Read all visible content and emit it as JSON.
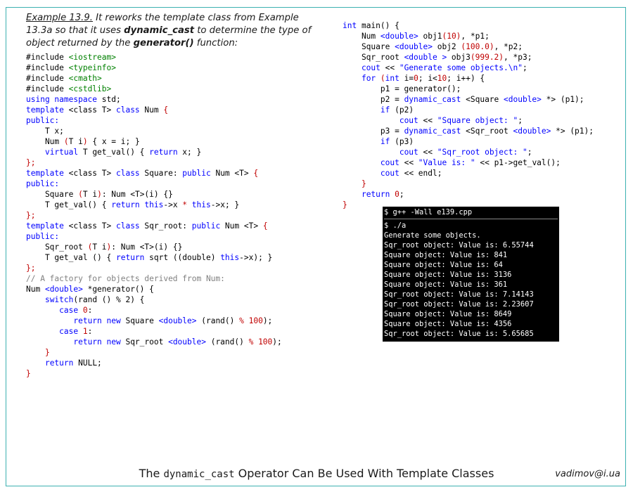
{
  "intro": {
    "example_label": "Example 13.9.",
    "text_1": " It reworks the template class from Example 13.3a so that it uses ",
    "kw_1": "dynamic_cast",
    "text_2": " to determine the type of object returned by the ",
    "kw_2": "generator()",
    "text_3": " function:"
  },
  "code_left": [
    [
      [
        "#include ",
        ""
      ],
      [
        "<iostream>",
        "inc"
      ]
    ],
    [
      [
        "#include ",
        ""
      ],
      [
        "<typeinfo>",
        "inc"
      ]
    ],
    [
      [
        "#include ",
        ""
      ],
      [
        "<cmath>",
        "inc"
      ]
    ],
    [
      [
        "#include ",
        ""
      ],
      [
        "<cstdlib>",
        "inc"
      ]
    ],
    [
      [
        "using namespace ",
        "k"
      ],
      [
        "std;",
        ""
      ]
    ],
    [
      [
        "template ",
        "k"
      ],
      [
        "<class T> ",
        ""
      ],
      [
        "class ",
        "k"
      ],
      [
        "Num ",
        ""
      ],
      [
        "{",
        "r"
      ]
    ],
    [
      [
        "public:",
        "k"
      ]
    ],
    [
      [
        "    T x;",
        ""
      ]
    ],
    [
      [
        "    Num ",
        ""
      ],
      [
        "(",
        "r"
      ],
      [
        "T i",
        ""
      ],
      [
        ")",
        "r"
      ],
      [
        " { x = i; } ",
        ""
      ]
    ],
    [
      [
        "    ",
        ""
      ],
      [
        "virtual ",
        "k"
      ],
      [
        "T get_val() { ",
        ""
      ],
      [
        "return ",
        "k"
      ],
      [
        "x; }",
        ""
      ]
    ],
    [
      [
        "};",
        "r"
      ]
    ],
    [
      [
        "template ",
        "k"
      ],
      [
        "<class T> ",
        ""
      ],
      [
        "class ",
        "k"
      ],
      [
        "Square: ",
        ""
      ],
      [
        "public ",
        "k"
      ],
      [
        "Num <T> ",
        ""
      ],
      [
        "{",
        "r"
      ]
    ],
    [
      [
        "public:",
        "k"
      ]
    ],
    [
      [
        "    Square ",
        ""
      ],
      [
        "(",
        "r"
      ],
      [
        "T i",
        ""
      ],
      [
        ")",
        "r"
      ],
      [
        ": Num <T>(i) {}",
        ""
      ]
    ],
    [
      [
        "    T get_val() { ",
        ""
      ],
      [
        "return this",
        "k"
      ],
      [
        "->x ",
        ""
      ],
      [
        "* ",
        "r"
      ],
      [
        "this",
        "k"
      ],
      [
        "->x; }",
        ""
      ]
    ],
    [
      [
        "};",
        "r"
      ]
    ],
    [
      [
        "template ",
        "k"
      ],
      [
        "<class T> ",
        ""
      ],
      [
        "class ",
        "k"
      ],
      [
        "Sqr_root: ",
        ""
      ],
      [
        "public ",
        "k"
      ],
      [
        "Num <T> ",
        ""
      ],
      [
        "{",
        "r"
      ]
    ],
    [
      [
        "public:",
        "k"
      ]
    ],
    [
      [
        "    Sqr_root ",
        ""
      ],
      [
        "(",
        "r"
      ],
      [
        "T i",
        ""
      ],
      [
        ")",
        "r"
      ],
      [
        ": Num <T>(i) {}",
        ""
      ]
    ],
    [
      [
        "    T get_val () { ",
        ""
      ],
      [
        "return ",
        "k"
      ],
      [
        "sqrt ((double) ",
        ""
      ],
      [
        "this",
        "k"
      ],
      [
        "->x); }",
        ""
      ]
    ],
    [
      [
        "};",
        "r"
      ]
    ],
    [
      [
        "// A factory for objects derived from Num:",
        "c"
      ]
    ],
    [
      [
        "Num ",
        ""
      ],
      [
        "<double> ",
        "k"
      ],
      [
        "*generator() {",
        ""
      ]
    ],
    [
      [
        "    ",
        ""
      ],
      [
        "switch",
        "k"
      ],
      [
        "(rand () % 2) {",
        ""
      ]
    ],
    [
      [
        "       ",
        ""
      ],
      [
        "case ",
        "k"
      ],
      [
        "0",
        "n"
      ],
      [
        ":",
        ""
      ]
    ],
    [
      [
        "          ",
        ""
      ],
      [
        "return new ",
        "k"
      ],
      [
        "Square ",
        ""
      ],
      [
        "<double> ",
        "k"
      ],
      [
        "(rand() ",
        ""
      ],
      [
        "% 100",
        "n"
      ],
      [
        ");",
        ""
      ]
    ],
    [
      [
        "       ",
        ""
      ],
      [
        "case ",
        "k"
      ],
      [
        "1",
        "n"
      ],
      [
        ":",
        ""
      ]
    ],
    [
      [
        "          ",
        ""
      ],
      [
        "return new ",
        "k"
      ],
      [
        "Sqr_root ",
        ""
      ],
      [
        "<double> ",
        "k"
      ],
      [
        "(rand() ",
        ""
      ],
      [
        "% 100",
        "n"
      ],
      [
        ");",
        ""
      ]
    ],
    [
      [
        "    }",
        "r"
      ]
    ],
    [
      [
        "    ",
        ""
      ],
      [
        "return ",
        "k"
      ],
      [
        "NULL;",
        ""
      ]
    ],
    [
      [
        "}",
        "r"
      ]
    ]
  ],
  "code_right": [
    [
      [
        "int ",
        "k"
      ],
      [
        "main() {",
        ""
      ]
    ],
    [
      [
        "    Num ",
        ""
      ],
      [
        "<double> ",
        "k"
      ],
      [
        "obj1",
        ""
      ],
      [
        "(10)",
        "n"
      ],
      [
        ", *p1;",
        ""
      ]
    ],
    [
      [
        "    Square ",
        ""
      ],
      [
        "<double> ",
        "k"
      ],
      [
        "obj2 ",
        ""
      ],
      [
        "(100.0)",
        "n"
      ],
      [
        ", *p2;",
        ""
      ]
    ],
    [
      [
        "    Sqr_root ",
        ""
      ],
      [
        "<double > ",
        "k"
      ],
      [
        "obj3",
        ""
      ],
      [
        "(999.2)",
        "n"
      ],
      [
        ", *p3;",
        ""
      ]
    ],
    [
      [
        "    cout ",
        "k"
      ],
      [
        "<< ",
        ""
      ],
      [
        "\"Generate some objects.\\n\"",
        "s"
      ],
      [
        ";",
        ""
      ]
    ],
    [
      [
        "    ",
        ""
      ],
      [
        "for ",
        "k"
      ],
      [
        "(",
        "r"
      ],
      [
        "int ",
        "k"
      ],
      [
        "i=",
        ""
      ],
      [
        "0",
        "n"
      ],
      [
        "; i<",
        ""
      ],
      [
        "10",
        "n"
      ],
      [
        "; i++) {",
        ""
      ]
    ],
    [
      [
        "        p1 = generator();",
        ""
      ]
    ],
    [
      [
        "        p2 = ",
        ""
      ],
      [
        "dynamic_cast ",
        "k"
      ],
      [
        "<Square ",
        ""
      ],
      [
        "<double> ",
        "k"
      ],
      [
        "*> (p1);",
        ""
      ]
    ],
    [
      [
        "        ",
        ""
      ],
      [
        "if ",
        "k"
      ],
      [
        "(p2)",
        ""
      ]
    ],
    [
      [
        "            ",
        ""
      ],
      [
        "cout ",
        "k"
      ],
      [
        "<< ",
        ""
      ],
      [
        "\"Square object: \"",
        "s"
      ],
      [
        ";",
        ""
      ]
    ],
    [
      [
        "        p3 = ",
        ""
      ],
      [
        "dynamic_cast ",
        "k"
      ],
      [
        "<Sqr_root ",
        ""
      ],
      [
        "<double> ",
        "k"
      ],
      [
        "*> (p1);",
        ""
      ]
    ],
    [
      [
        "        ",
        ""
      ],
      [
        "if ",
        "k"
      ],
      [
        "(p3)",
        ""
      ]
    ],
    [
      [
        "            ",
        ""
      ],
      [
        "cout ",
        "k"
      ],
      [
        "<< ",
        ""
      ],
      [
        "\"Sqr_root object: \"",
        "s"
      ],
      [
        ";",
        ""
      ]
    ],
    [
      [
        "        ",
        ""
      ],
      [
        "cout ",
        "k"
      ],
      [
        "<< ",
        ""
      ],
      [
        "\"Value is: \" ",
        "s"
      ],
      [
        "<< p1->get_val();",
        ""
      ]
    ],
    [
      [
        "        ",
        ""
      ],
      [
        "cout ",
        "k"
      ],
      [
        "<< endl;",
        ""
      ]
    ],
    [
      [
        "    }",
        "r"
      ]
    ],
    [
      [
        "    ",
        ""
      ],
      [
        "return ",
        "k"
      ],
      [
        "0",
        "n"
      ],
      [
        ";",
        ""
      ]
    ],
    [
      [
        "}",
        "r"
      ]
    ]
  ],
  "terminal": {
    "command": "$ g++ -Wall e139.cpp",
    "run": "$ ./a",
    "output": [
      "Generate some objects.",
      "Sqr_root object: Value is: 6.55744",
      "Square object: Value is: 841",
      "Square object: Value is: 64",
      "Square object: Value is: 3136",
      "Square object: Value is: 361",
      "Sqr_root object: Value is: 7.14143",
      "Sqr_root object: Value is: 2.23607",
      "Square object: Value is: 8649",
      "Square object: Value is: 4356",
      "Sqr_root object: Value is: 5.65685"
    ]
  },
  "footer": {
    "title_pre": "The ",
    "title_code": "dynamic_cast",
    "title_post": " Operator Can Be Used With Template Classes",
    "author": "vadimov@i.ua"
  },
  "colors": {
    "border": "#3cb1b1",
    "keyword": "#0000ff",
    "number": "#c00000",
    "comment": "#808080",
    "include": "#008000",
    "terminal_bg": "#000000"
  }
}
